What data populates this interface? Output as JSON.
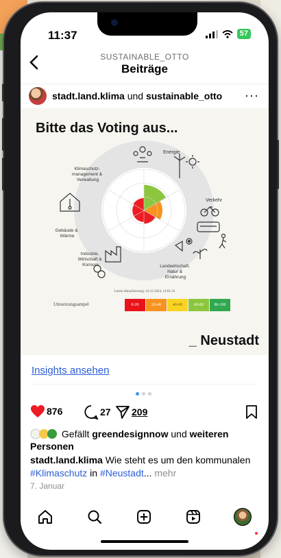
{
  "status": {
    "time": "11:37",
    "battery": "57"
  },
  "header": {
    "username": "SUSTAINABLE_OTTO",
    "title": "Beiträge"
  },
  "post": {
    "author_primary": "stadt.land.klima",
    "author_join": "und",
    "author_secondary": "sustainable_otto",
    "more": "···"
  },
  "media": {
    "title": "Bitte das Voting aus...",
    "brand": "_ Neustadt",
    "update_text": "Letzte Aktualisierung: 10.12.2024, 14:01:33",
    "wheel_segments": [
      {
        "label": "Energie",
        "level": 0.62,
        "color": "#8cc63f"
      },
      {
        "label": "Verkehr",
        "level": 0.45,
        "color": "#f7931e"
      },
      {
        "label": "Landwirtschaft, Natur & Ernährung",
        "level": 0.32,
        "color": "#ed1c24"
      },
      {
        "label": "Industrie, Wirtschaft & Konsum",
        "level": 0.28,
        "color": "#ed1c24"
      },
      {
        "label": "Gebäude & Wärme",
        "level": 0.28,
        "color": "#ed1c24"
      },
      {
        "label": "Klimaschutz-management & Verwaltung",
        "level": 0.3,
        "color": "#ed1c24"
      }
    ],
    "labels": {
      "energie": "Energie",
      "klimaschutz": [
        "Klimaschutz-",
        "management &",
        "Verwaltung"
      ],
      "verkehr": "Verkehr",
      "gebaeude": [
        "Gebäude &",
        "Wärme"
      ],
      "industrie": [
        "Industrie,",
        "Wirtschaft &",
        "Konsum"
      ],
      "landwirtschaft": [
        "Landwirtschaft,",
        "Natur &",
        "Ernährung"
      ]
    },
    "legend": {
      "title": "Umsetzungsampel",
      "items": [
        {
          "label": "0-20",
          "color": "#e8131b"
        },
        {
          "label": "20-40",
          "color": "#f7931e"
        },
        {
          "label": "40-60",
          "color": "#f9d423"
        },
        {
          "label": "60-80",
          "color": "#8cc63f"
        },
        {
          "label": "80-100",
          "color": "#2fa84f"
        }
      ]
    }
  },
  "insights": "Insights ansehen",
  "actions": {
    "likes": "876",
    "comments": "27",
    "shares": "209"
  },
  "liked_by": {
    "prefix": "Gefällt",
    "user": "greendesignnow",
    "join": "und",
    "others": "weiteren Personen"
  },
  "caption": {
    "author": "stadt.land.klima",
    "text1": "Wie steht es um den kommunalen",
    "tag1": "#Klimaschutz",
    "text2": "in",
    "tag2": "#Neustadt",
    "ellipsis": "...",
    "more": "mehr"
  },
  "date": "7. Januar",
  "colors": {
    "link": "#2a5dd7",
    "like": "#ed1c24",
    "dot_active": "#3897f0"
  }
}
